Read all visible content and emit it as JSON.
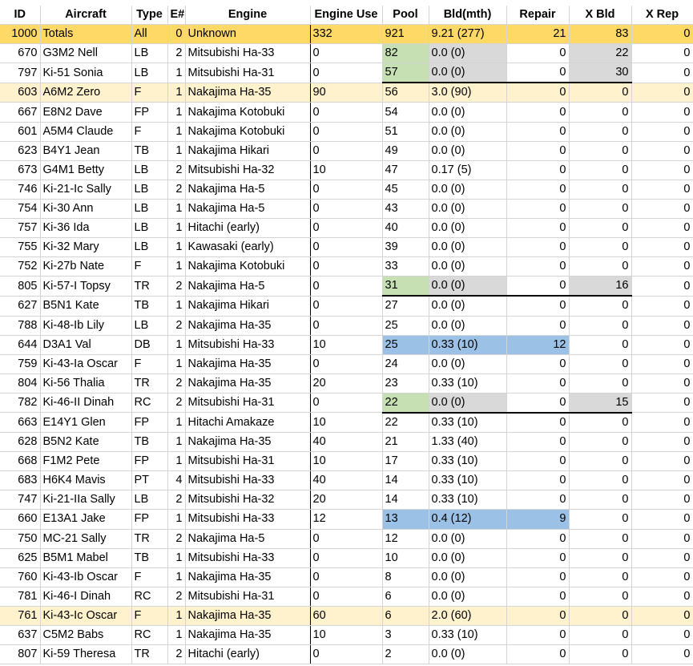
{
  "headers": [
    "ID",
    "Aircraft",
    "Type",
    "E#",
    "Engine",
    "Engine Use",
    "Pool",
    "Bld(mth)",
    "Repair",
    "X Bld",
    "X Rep"
  ],
  "rows": [
    {
      "c": [
        "1000",
        "Totals",
        "All",
        "0",
        "Unknown",
        "332",
        "921",
        "9.21 (277)",
        "21",
        "83",
        "0"
      ],
      "style": "totals"
    },
    {
      "c": [
        "670",
        "G3M2 Nell",
        "LB",
        "2",
        "Mitsubishi Ha-33",
        "0",
        "82",
        "0.0 (0)",
        "0",
        "22",
        "0"
      ],
      "pool": "green",
      "bld": "gray",
      "xbld": "gray"
    },
    {
      "c": [
        "797",
        "Ki-51 Sonia",
        "LB",
        "1",
        "Mitsubishi Ha-31",
        "0",
        "57",
        "0.0 (0)",
        "0",
        "30",
        "0"
      ],
      "pool": "green",
      "bld": "gray",
      "xbld": "gray",
      "under": true
    },
    {
      "c": [
        "603",
        "A6M2 Zero",
        "F",
        "1",
        "Nakajima Ha-35",
        "90",
        "56",
        "3.0 (90)",
        "0",
        "0",
        "0"
      ],
      "style": "hl"
    },
    {
      "c": [
        "667",
        "E8N2 Dave",
        "FP",
        "1",
        "Nakajima Kotobuki",
        "0",
        "54",
        "0.0 (0)",
        "0",
        "0",
        "0"
      ]
    },
    {
      "c": [
        "601",
        "A5M4 Claude",
        "F",
        "1",
        "Nakajima Kotobuki",
        "0",
        "51",
        "0.0 (0)",
        "0",
        "0",
        "0"
      ]
    },
    {
      "c": [
        "623",
        "B4Y1 Jean",
        "TB",
        "1",
        "Nakajima Hikari",
        "0",
        "49",
        "0.0 (0)",
        "0",
        "0",
        "0"
      ]
    },
    {
      "c": [
        "673",
        "G4M1 Betty",
        "LB",
        "2",
        "Mitsubishi Ha-32",
        "10",
        "47",
        "0.17 (5)",
        "0",
        "0",
        "0"
      ]
    },
    {
      "c": [
        "746",
        "Ki-21-Ic Sally",
        "LB",
        "2",
        "Nakajima Ha-5",
        "0",
        "45",
        "0.0 (0)",
        "0",
        "0",
        "0"
      ]
    },
    {
      "c": [
        "754",
        "Ki-30 Ann",
        "LB",
        "1",
        "Nakajima Ha-5",
        "0",
        "43",
        "0.0 (0)",
        "0",
        "0",
        "0"
      ]
    },
    {
      "c": [
        "757",
        "Ki-36 Ida",
        "LB",
        "1",
        "Hitachi (early)",
        "0",
        "40",
        "0.0 (0)",
        "0",
        "0",
        "0"
      ]
    },
    {
      "c": [
        "755",
        "Ki-32 Mary",
        "LB",
        "1",
        "Kawasaki (early)",
        "0",
        "39",
        "0.0 (0)",
        "0",
        "0",
        "0"
      ]
    },
    {
      "c": [
        "752",
        "Ki-27b Nate",
        "F",
        "1",
        "Nakajima Kotobuki",
        "0",
        "33",
        "0.0 (0)",
        "0",
        "0",
        "0"
      ]
    },
    {
      "c": [
        "805",
        "Ki-57-I Topsy",
        "TR",
        "2",
        "Nakajima Ha-5",
        "0",
        "31",
        "0.0 (0)",
        "0",
        "16",
        "0"
      ],
      "pool": "green",
      "bld": "gray",
      "xbld": "gray",
      "under": true
    },
    {
      "c": [
        "627",
        "B5N1 Kate",
        "TB",
        "1",
        "Nakajima Hikari",
        "0",
        "27",
        "0.0 (0)",
        "0",
        "0",
        "0"
      ]
    },
    {
      "c": [
        "788",
        "Ki-48-Ib Lily",
        "LB",
        "2",
        "Nakajima Ha-35",
        "0",
        "25",
        "0.0 (0)",
        "0",
        "0",
        "0"
      ]
    },
    {
      "c": [
        "644",
        "D3A1 Val",
        "DB",
        "1",
        "Mitsubishi Ha-33",
        "10",
        "25",
        "0.33 (10)",
        "12",
        "0",
        "0"
      ],
      "pool": "blue",
      "bld": "blue",
      "repair": "blue"
    },
    {
      "c": [
        "759",
        "Ki-43-Ia Oscar",
        "F",
        "1",
        "Nakajima Ha-35",
        "0",
        "24",
        "0.0 (0)",
        "0",
        "0",
        "0"
      ]
    },
    {
      "c": [
        "804",
        "Ki-56 Thalia",
        "TR",
        "2",
        "Nakajima Ha-35",
        "20",
        "23",
        "0.33 (10)",
        "0",
        "0",
        "0"
      ]
    },
    {
      "c": [
        "782",
        "Ki-46-II Dinah",
        "RC",
        "2",
        "Mitsubishi Ha-31",
        "0",
        "22",
        "0.0 (0)",
        "0",
        "15",
        "0"
      ],
      "pool": "green",
      "bld": "gray",
      "xbld": "gray",
      "under": true
    },
    {
      "c": [
        "663",
        "E14Y1 Glen",
        "FP",
        "1",
        "Hitachi Amakaze",
        "10",
        "22",
        "0.33 (10)",
        "0",
        "0",
        "0"
      ]
    },
    {
      "c": [
        "628",
        "B5N2 Kate",
        "TB",
        "1",
        "Nakajima Ha-35",
        "40",
        "21",
        "1.33 (40)",
        "0",
        "0",
        "0"
      ]
    },
    {
      "c": [
        "668",
        "F1M2 Pete",
        "FP",
        "1",
        "Mitsubishi Ha-31",
        "10",
        "17",
        "0.33 (10)",
        "0",
        "0",
        "0"
      ]
    },
    {
      "c": [
        "683",
        "H6K4 Mavis",
        "PT",
        "4",
        "Mitsubishi Ha-33",
        "40",
        "14",
        "0.33 (10)",
        "0",
        "0",
        "0"
      ]
    },
    {
      "c": [
        "747",
        "Ki-21-IIa Sally",
        "LB",
        "2",
        "Mitsubishi Ha-32",
        "20",
        "14",
        "0.33 (10)",
        "0",
        "0",
        "0"
      ]
    },
    {
      "c": [
        "660",
        "E13A1 Jake",
        "FP",
        "1",
        "Mitsubishi Ha-33",
        "12",
        "13",
        "0.4 (12)",
        "9",
        "0",
        "0"
      ],
      "pool": "blue",
      "bld": "blue",
      "repair": "blue"
    },
    {
      "c": [
        "750",
        "MC-21 Sally",
        "TR",
        "2",
        "Nakajima Ha-5",
        "0",
        "12",
        "0.0 (0)",
        "0",
        "0",
        "0"
      ]
    },
    {
      "c": [
        "625",
        "B5M1 Mabel",
        "TB",
        "1",
        "Mitsubishi Ha-33",
        "0",
        "10",
        "0.0 (0)",
        "0",
        "0",
        "0"
      ]
    },
    {
      "c": [
        "760",
        "Ki-43-Ib Oscar",
        "F",
        "1",
        "Nakajima Ha-35",
        "0",
        "8",
        "0.0 (0)",
        "0",
        "0",
        "0"
      ]
    },
    {
      "c": [
        "781",
        "Ki-46-I Dinah",
        "RC",
        "2",
        "Mitsubishi Ha-31",
        "0",
        "6",
        "0.0 (0)",
        "0",
        "0",
        "0"
      ]
    },
    {
      "c": [
        "761",
        "Ki-43-Ic Oscar",
        "F",
        "1",
        "Nakajima Ha-35",
        "60",
        "6",
        "2.0 (60)",
        "0",
        "0",
        "0"
      ],
      "style": "hl"
    },
    {
      "c": [
        "637",
        "C5M2 Babs",
        "RC",
        "1",
        "Nakajima Ha-35",
        "10",
        "3",
        "0.33 (10)",
        "0",
        "0",
        "0"
      ]
    },
    {
      "c": [
        "807",
        "Ki-59 Theresa",
        "TR",
        "2",
        "Hitachi (early)",
        "0",
        "2",
        "0.0 (0)",
        "0",
        "0",
        "0"
      ]
    }
  ]
}
